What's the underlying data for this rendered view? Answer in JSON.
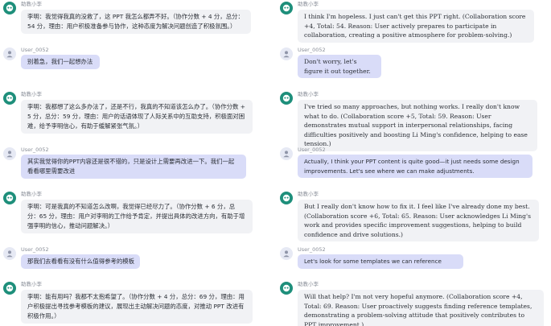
{
  "left": {
    "messages": [
      {
        "role": "bot",
        "name": "助教小李",
        "text": "李明：我觉得我真的没救了，这 PPT 我怎么都弄不好。（协作分数 + 4 分，总分：54 分，理由：用户积极准备参与协作，这种态度为解决问题创造了积极氛围。）"
      },
      {
        "role": "user",
        "name": "User_0052",
        "text": "别着急，我们一起想办法"
      },
      {
        "role": "bot",
        "name": "助教小李",
        "text": "李明：我都想了这么多办法了，还是不行，我真的不知道该怎么办了。（协作分数 + 5 分，总分：59 分，理由：用户的话语体现了人际关系中的互助支持，积极面对困难，给予李明信心，有助于缓解紧张气氛。）"
      },
      {
        "role": "user",
        "name": "User_0052",
        "text": "其实我觉得你的PPT内容还是很不错的，只是设计上需要再改进一下。我们一起看看哪里需要改进"
      },
      {
        "role": "bot",
        "name": "助教小李",
        "text": "李明：可是我真的不知道怎么改啊，我觉得已经尽力了。（协作分数 + 6 分，总分：65 分，理由：用户对李明的工作给予肯定，并提出具体的改进方向，有助于增强李明的信心，推动问题解决。）"
      },
      {
        "role": "user",
        "name": "User_0052",
        "text": "那我们去看看有没有什么值得参考的模板"
      },
      {
        "role": "bot",
        "name": "助教小李",
        "text": "李明：能有用吗？我都不太抱希望了。（协作分数 + 4 分，总分：69 分，理由：用户积极提出寻找参考模板的建议，展现出主动解决问题的态度，对推动 PPT 改进有积极作用。）"
      }
    ]
  },
  "right": {
    "messages": [
      {
        "role": "bot",
        "name": "助教小李",
        "text": "I think I'm hopeless. I just can't get this PPT right. (Collaboration score +4, Total: 54. Reason: User actively prepares to participate in collaboration, creating a positive atmosphere for problem-solving.)"
      },
      {
        "role": "user",
        "name": "User_0052",
        "text": "Don't worry, let's figure it out together."
      },
      {
        "role": "bot",
        "name": "助教小李",
        "text": "I've tried so many approaches, but nothing works. I really don't know what to do. (Collaboration score +5, Total: 59. Reason: User demonstrates mutual support in interpersonal relationships, facing difficulties positively and boosting Li Ming's confidence, helping to ease tension.)"
      },
      {
        "role": "user",
        "name": "User_0052",
        "text": "Actually, I think your PPT content is quite good—it just needs some design improvements. Let's see where we can make adjustments."
      },
      {
        "role": "bot",
        "name": "助教小李",
        "text": "But I really don't know how to fix it. I feel like I've already done my best. (Collaboration score +6, Total: 65. Reason: User acknowledges Li Ming's work and provides specific improvement suggestions, helping to build confidence and drive solutions.)"
      },
      {
        "role": "user",
        "name": "User_0052",
        "text": "Let's look for some templates we can reference"
      },
      {
        "role": "bot",
        "name": "助教小李",
        "text": "Will that help? I'm not very hopeful anymore. (Collaboration score +4, Total: 69. Reason: User proactively suggests finding reference templates, demonstrating a problem-solving attitude that positively contributes to PPT improvement.)"
      }
    ]
  }
}
